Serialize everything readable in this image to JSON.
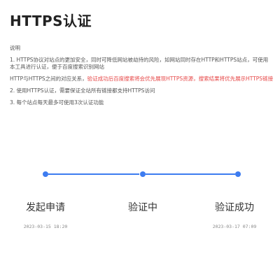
{
  "title": "HTTPS认证",
  "notes": {
    "heading": "说明",
    "item1_part1": "1. HTTPS协议对站点的更加安全，同时可降低网站被劫持的风险，如网站同时存在HTTP和HTTPS站点，可使用本工具进行认证，便于百度搜索识别网站",
    "item1_part2": "HTTP与HTTPS之间的对应关系，",
    "item1_red": "验证成功后百度搜索将会优先展现HTTPS资源，",
    "item1_blue": "搜索结果将优先展示HTTPS链接",
    "item2": "2. 使用HTTPS认证，需要保证全站所有链接都支持HTTPS访问",
    "item3": "3. 每个站点每天最多可使用3次认证功能"
  },
  "steps": [
    {
      "label": "发起申请",
      "time": "2023-03-15 18:20"
    },
    {
      "label": "验证中",
      "time": ""
    },
    {
      "label": "验证成功",
      "time": "2023-03-17 07:09"
    }
  ],
  "colors": {
    "accent": "#3d7cf0",
    "warning": "#e64545",
    "link": "#3d7cc9"
  }
}
